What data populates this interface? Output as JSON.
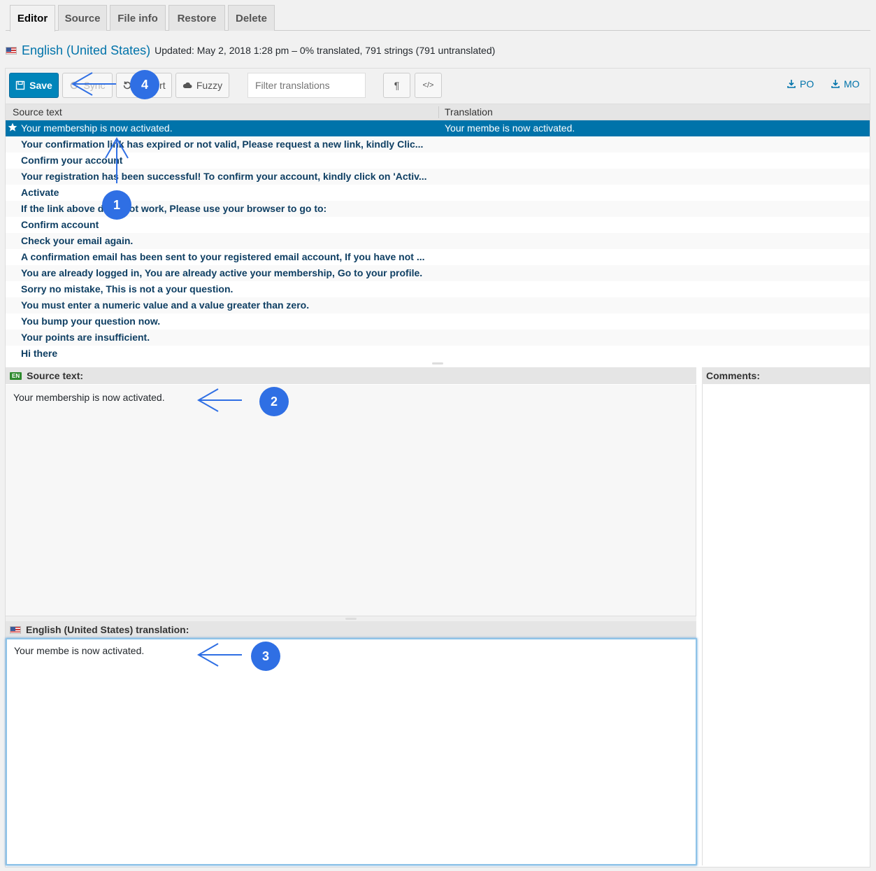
{
  "tabs": [
    {
      "label": "Editor",
      "active": true
    },
    {
      "label": "Source",
      "active": false
    },
    {
      "label": "File info",
      "active": false
    },
    {
      "label": "Restore",
      "active": false
    },
    {
      "label": "Delete",
      "active": false
    }
  ],
  "header": {
    "language": "English (United States)",
    "updated": "Updated: May 2, 2018 1:28 pm – 0% translated, 791 strings (791 untranslated)"
  },
  "toolbar": {
    "save_label": "Save",
    "sync_label": "Sync",
    "revert_label": "Revert",
    "fuzzy_label": "Fuzzy",
    "filter_placeholder": "Filter translations",
    "pilcrow_label": "¶",
    "code_label": "</>",
    "po_label": "PO",
    "mo_label": "MO"
  },
  "list": {
    "source_header": "Source text",
    "translation_header": "Translation",
    "rows": [
      {
        "source": "Your membership is now activated.",
        "translation": "Your membe is now activated."
      },
      {
        "source": "Your confirmation link has expired or not valid, Please request a new link, kindly Clic...",
        "translation": ""
      },
      {
        "source": "Confirm your account",
        "translation": ""
      },
      {
        "source": "Your registration has been successful! To confirm your account, kindly click on 'Activ...",
        "translation": ""
      },
      {
        "source": "Activate",
        "translation": ""
      },
      {
        "source": "If the link above does not work, Please use your browser to go to:",
        "translation": ""
      },
      {
        "source": "Confirm account",
        "translation": ""
      },
      {
        "source": "Check your email again.",
        "translation": ""
      },
      {
        "source": "A confirmation email has been sent to your registered email account, If you have not ...",
        "translation": ""
      },
      {
        "source": "You are already logged in, You are already active your membership, Go to your profile.",
        "translation": ""
      },
      {
        "source": "Sorry no mistake, This is not a your question.",
        "translation": ""
      },
      {
        "source": "You must enter a numeric value and a value greater than zero.",
        "translation": ""
      },
      {
        "source": "You bump your question now.",
        "translation": ""
      },
      {
        "source": "Your points are insufficient.",
        "translation": ""
      },
      {
        "source": "Hi there",
        "translation": ""
      }
    ]
  },
  "source_pane": {
    "badge": "EN",
    "title": "Source text:",
    "text": "Your membership is now activated."
  },
  "translation_pane": {
    "title": "English (United States) translation:",
    "text": "Your membe is now activated."
  },
  "comments_pane": {
    "title": "Comments:"
  },
  "callouts": [
    "1",
    "2",
    "3",
    "4"
  ],
  "colors": {
    "accent": "#0073aa",
    "primary_button": "#0085ba",
    "callout": "#2f6fe4",
    "row_text": "#0f3f63"
  }
}
